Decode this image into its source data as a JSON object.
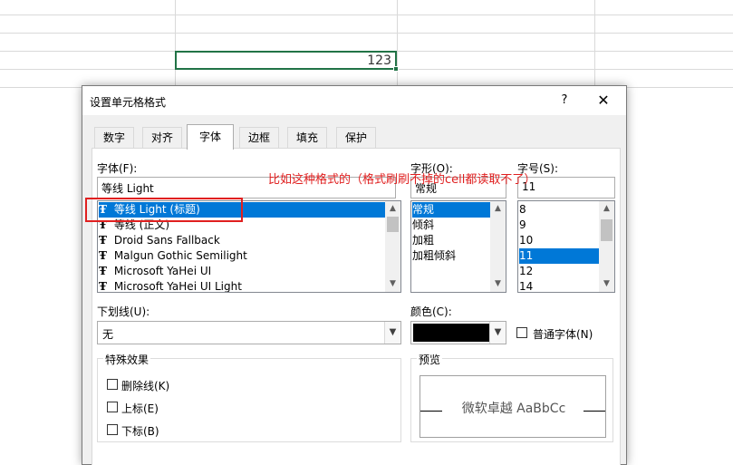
{
  "sheet": {
    "active_cell_value": "123"
  },
  "dialog": {
    "title": "设置单元格格式",
    "help": "?",
    "close": "✕",
    "tabs": [
      {
        "label": "数字",
        "selected": false
      },
      {
        "label": "对齐",
        "selected": false
      },
      {
        "label": "字体",
        "selected": true
      },
      {
        "label": "边框",
        "selected": false
      },
      {
        "label": "填充",
        "selected": false
      },
      {
        "label": "保护",
        "selected": false
      }
    ],
    "font": {
      "label": "字体(F):",
      "value": "等线 Light",
      "items": [
        "等线 Light (标题)",
        "等线 (正文)",
        "Droid Sans Fallback",
        "Malgun Gothic Semilight",
        "Microsoft YaHei UI",
        "Microsoft YaHei UI Light"
      ],
      "selected_index": 0
    },
    "style": {
      "label": "字形(O):",
      "value": "常规",
      "items": [
        "常规",
        "倾斜",
        "加粗",
        "加粗倾斜"
      ],
      "selected_index": 0
    },
    "size": {
      "label": "字号(S):",
      "value": "11",
      "items": [
        "8",
        "9",
        "10",
        "11",
        "12",
        "14"
      ],
      "selected_index": 3
    },
    "underline": {
      "label": "下划线(U):",
      "value": "无"
    },
    "color": {
      "label": "颜色(C):",
      "value": "#000000"
    },
    "normal_font": {
      "label": "普通字体(N)"
    },
    "effects": {
      "title": "特殊效果",
      "strikethrough": "删除线(K)",
      "superscript": "上标(E)",
      "subscript": "下标(B)"
    },
    "preview": {
      "title": "预览",
      "sample": "微软卓越  AaBbCc"
    }
  },
  "annotation": {
    "text": "比如这种格式的（格式刷刷不掉的cell都读取不了）",
    "color": "#e02020"
  },
  "colors": {
    "selection": "#0078d7",
    "cell_border": "#217346"
  }
}
